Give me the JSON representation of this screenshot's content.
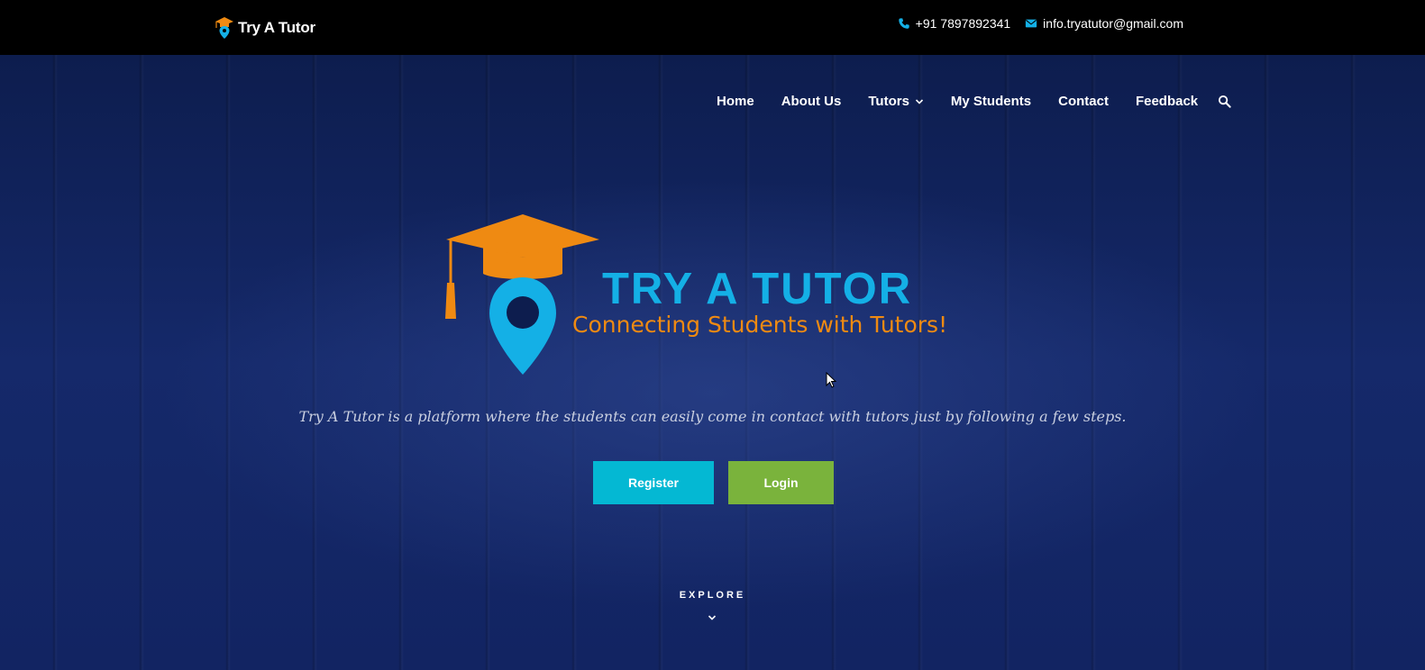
{
  "header": {
    "brand_name": "Try A Tutor",
    "phone": "+91 7897892341",
    "email": "info.tryatutor@gmail.com"
  },
  "nav": {
    "items": [
      "Home",
      "About Us",
      "Tutors",
      "My Students",
      "Contact",
      "Feedback"
    ]
  },
  "hero": {
    "logo_title": "TRY A TUTOR",
    "logo_subtitle": "Connecting Students with Tutors!",
    "tagline": "Try A Tutor is a platform where the students can easily come in contact with tutors just by following a few steps.",
    "register_label": "Register",
    "login_label": "Login",
    "explore_label": "EXPLORE"
  },
  "colors": {
    "topbar_bg": "#000000",
    "accent_cyan": "#04b8d3",
    "accent_green": "#7ab33c",
    "logo_orange": "#ef8a12",
    "logo_blue": "#14b0e6",
    "hero_bg": "#15296a"
  },
  "icons": [
    "brand-logo-icon",
    "phone-icon",
    "envelope-icon",
    "chevron-down-icon",
    "search-icon",
    "graduation-cap-pin-icon",
    "cursor-icon"
  ]
}
